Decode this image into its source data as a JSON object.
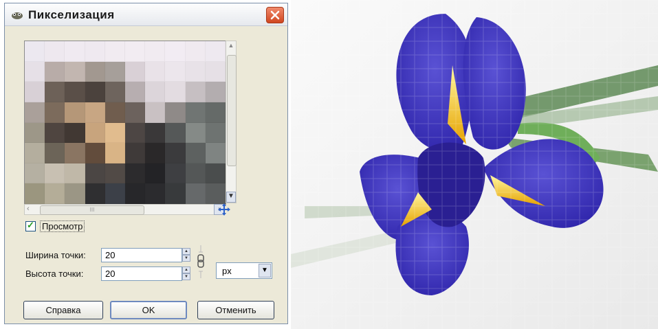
{
  "dialog": {
    "title": "Пикселизация",
    "close_icon": "close-icon",
    "preview_label": "Просмотр",
    "preview_checked": true,
    "width_label": "Ширина точки:",
    "width_value": "20",
    "height_label": "Высота точки:",
    "height_value": "20",
    "unit_value": "px",
    "help_label": "Справка",
    "ok_label": "OK",
    "cancel_label": "Отменить",
    "scroll_thumb_mark": "III"
  },
  "colors": {
    "accent": "#4e44c4",
    "dialog_bg": "#ece9d8",
    "close_red": "#d0461f"
  }
}
